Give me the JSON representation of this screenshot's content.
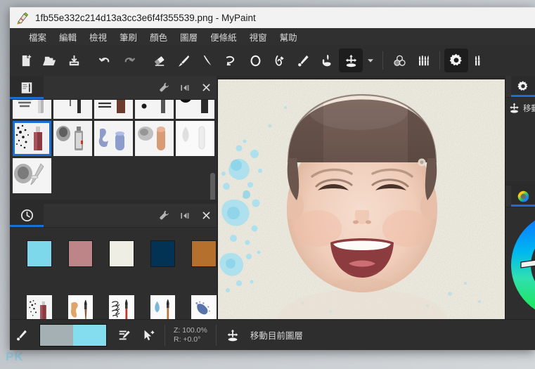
{
  "window": {
    "title": "1fb55e332c214d13a3cc3e6f4f355539.png - MyPaint",
    "app_icon": "mypaint-logo-icon"
  },
  "watermark": {
    "text": "PK"
  },
  "menubar": {
    "items": [
      {
        "label": "檔案",
        "name": "menu-file"
      },
      {
        "label": "編輯",
        "name": "menu-edit"
      },
      {
        "label": "檢視",
        "name": "menu-view"
      },
      {
        "label": "筆刷",
        "name": "menu-brush"
      },
      {
        "label": "顏色",
        "name": "menu-color"
      },
      {
        "label": "圖層",
        "name": "menu-layer"
      },
      {
        "label": "便條紙",
        "name": "menu-scratchpad"
      },
      {
        "label": "視窗",
        "name": "menu-window"
      },
      {
        "label": "幫助",
        "name": "menu-help"
      }
    ]
  },
  "toolbar": {
    "items": [
      {
        "name": "new-file-icon",
        "tip": "新增"
      },
      {
        "name": "open-file-icon",
        "tip": "開啟"
      },
      {
        "name": "save-file-icon",
        "tip": "儲存"
      },
      {
        "name": "undo-icon",
        "tip": "復原"
      },
      {
        "name": "redo-icon",
        "tip": "重做"
      },
      {
        "name": "eraser-icon",
        "tip": "橡皮擦"
      },
      {
        "name": "paintbrush-icon",
        "tip": "筆刷"
      },
      {
        "name": "line-tool-icon",
        "tip": "直線"
      },
      {
        "name": "curve-tool-icon",
        "tip": "曲線"
      },
      {
        "name": "ellipse-tool-icon",
        "tip": "橢圓"
      },
      {
        "name": "inking-tool-icon",
        "tip": "墨線"
      },
      {
        "name": "color-picker-icon",
        "tip": "取色器"
      },
      {
        "name": "flood-fill-icon",
        "tip": "填色"
      },
      {
        "name": "move-layer-icon",
        "tip": "移動圖層",
        "active": true
      },
      {
        "name": "chevron-down-icon",
        "tip": "更多"
      },
      {
        "name": "color-circles-icon",
        "tip": "顏色"
      },
      {
        "name": "brushes-icon",
        "tip": "筆刷清單"
      },
      {
        "name": "preferences-gear-icon",
        "tip": "設定",
        "active": true
      },
      {
        "name": "brush-settings-icon",
        "tip": "筆刷設定"
      }
    ]
  },
  "brush_panel": {
    "tab_icon": "brush-group-icon",
    "buttons": [
      {
        "name": "wrench-icon"
      },
      {
        "name": "collapse-panel-icon"
      },
      {
        "name": "close-panel-icon"
      }
    ],
    "rows": [
      [
        {
          "name": "brush-charcoal",
          "sel": false
        },
        {
          "name": "brush-pencil",
          "sel": false
        },
        {
          "name": "brush-marker",
          "sel": false
        },
        {
          "name": "brush-blob",
          "sel": false
        },
        {
          "name": "brush-dot",
          "sel": false
        }
      ],
      [
        {
          "name": "brush-spray-red",
          "sel": true
        },
        {
          "name": "brush-spray-gray",
          "sel": false
        },
        {
          "name": "brush-smudge-blue",
          "sel": false
        },
        {
          "name": "brush-finger",
          "sel": false
        },
        {
          "name": "brush-airbrush",
          "sel": false
        }
      ],
      [
        {
          "name": "brush-soft-pen",
          "sel": false
        }
      ]
    ]
  },
  "palette_panel": {
    "tab_icon": "history-clock-icon",
    "buttons": [
      {
        "name": "wrench-icon"
      },
      {
        "name": "collapse-panel-icon"
      },
      {
        "name": "close-panel-icon"
      }
    ],
    "swatches": [
      {
        "name": "swatch-cyan",
        "color": "#7dd8ec"
      },
      {
        "name": "swatch-rose",
        "color": "#be8588"
      },
      {
        "name": "swatch-cream",
        "color": "#efeee4"
      },
      {
        "name": "swatch-navy",
        "color": "#033354"
      },
      {
        "name": "swatch-ochre",
        "color": "#b4702c"
      }
    ],
    "history": [
      {
        "name": "recent-brush-spray"
      },
      {
        "name": "recent-brush-watercolor"
      },
      {
        "name": "recent-brush-scribble"
      },
      {
        "name": "recent-brush-ink-drop"
      },
      {
        "name": "recent-brush-blue-splat"
      }
    ]
  },
  "canvas": {
    "name": "drawing-canvas",
    "background_color": "#efece0",
    "subject": "baby-with-striped-beanie-photo"
  },
  "right_dock": {
    "panels": [
      {
        "tab_icon": "preferences-gear-icon",
        "label": "移動目前圖層",
        "label_icon": "move-layer-icon"
      },
      {
        "tab_icon": "color-wheel-icon",
        "label": ""
      }
    ]
  },
  "statusbar": {
    "picker_icon": "color-picker-icon",
    "color_left": "#a4b0b3",
    "color_right": "#84dcef",
    "buttons": [
      {
        "name": "edit-line-icon"
      },
      {
        "name": "cursor-add-icon"
      }
    ],
    "zoom_label": "Z: 100.0%",
    "rotation_label": "R: +0.0°",
    "mode_icon": "move-layer-icon",
    "mode_text": "移動目前圖層"
  }
}
